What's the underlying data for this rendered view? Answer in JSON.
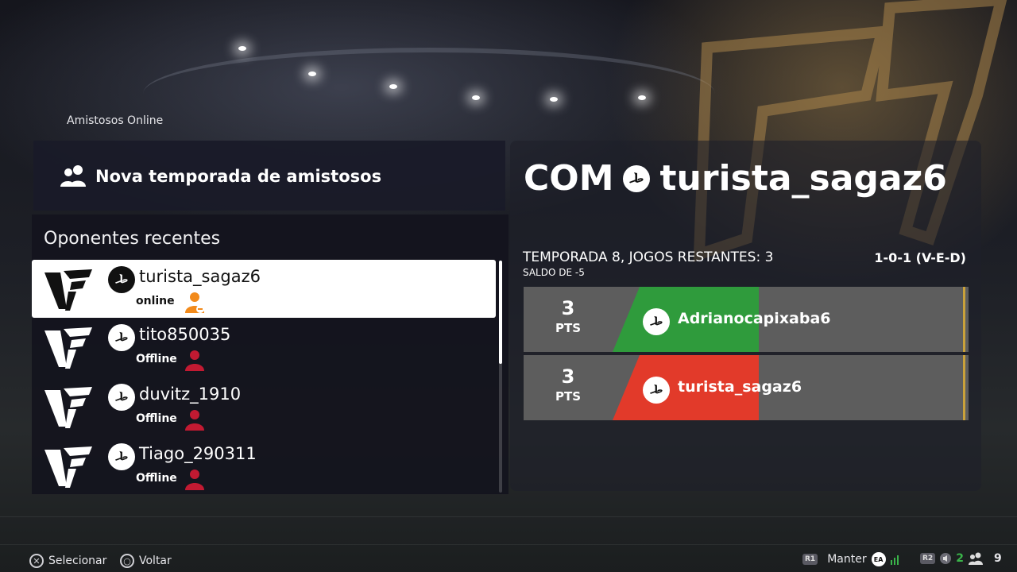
{
  "breadcrumb": "Amistosos Online",
  "new_season": {
    "label": "Nova temporada de amistosos"
  },
  "recent": {
    "title": "Oponentes recentes",
    "items": [
      {
        "name": "turista_sagaz6",
        "status": "online",
        "selected": true,
        "status_color": "#f28a1b"
      },
      {
        "name": "tito850035",
        "status": "Offline",
        "selected": false,
        "status_color": "#c21a32"
      },
      {
        "name": "duvitz_1910",
        "status": "Offline",
        "selected": false,
        "status_color": "#c21a32"
      },
      {
        "name": "Tiago_290311",
        "status": "Offline",
        "selected": false,
        "status_color": "#c21a32"
      }
    ]
  },
  "detail": {
    "prefix": "COM",
    "opponent": "turista_sagaz6",
    "season_text": "TEMPORADA 8, JOGOS RESTANTES: 3",
    "balance_text": "SALDO DE -5",
    "record": "1-0-1 (V-E-D)",
    "scores": [
      {
        "points": "3",
        "pts_label": "PTS",
        "player": "Adrianocapixaba6",
        "color": "#2f9b3c"
      },
      {
        "points": "3",
        "pts_label": "PTS",
        "player": "turista_sagaz6",
        "color": "#e23a2a"
      }
    ]
  },
  "footer": {
    "select_label": "Selecionar",
    "back_label": "Voltar",
    "hold_label": "Manter",
    "r1": "R1",
    "r2": "R2",
    "ea": "EA",
    "count_green": "2",
    "count_users": "9"
  },
  "colors": {
    "online": "#f28a1b",
    "offline": "#c21a32",
    "gold": "#c9a13a"
  }
}
